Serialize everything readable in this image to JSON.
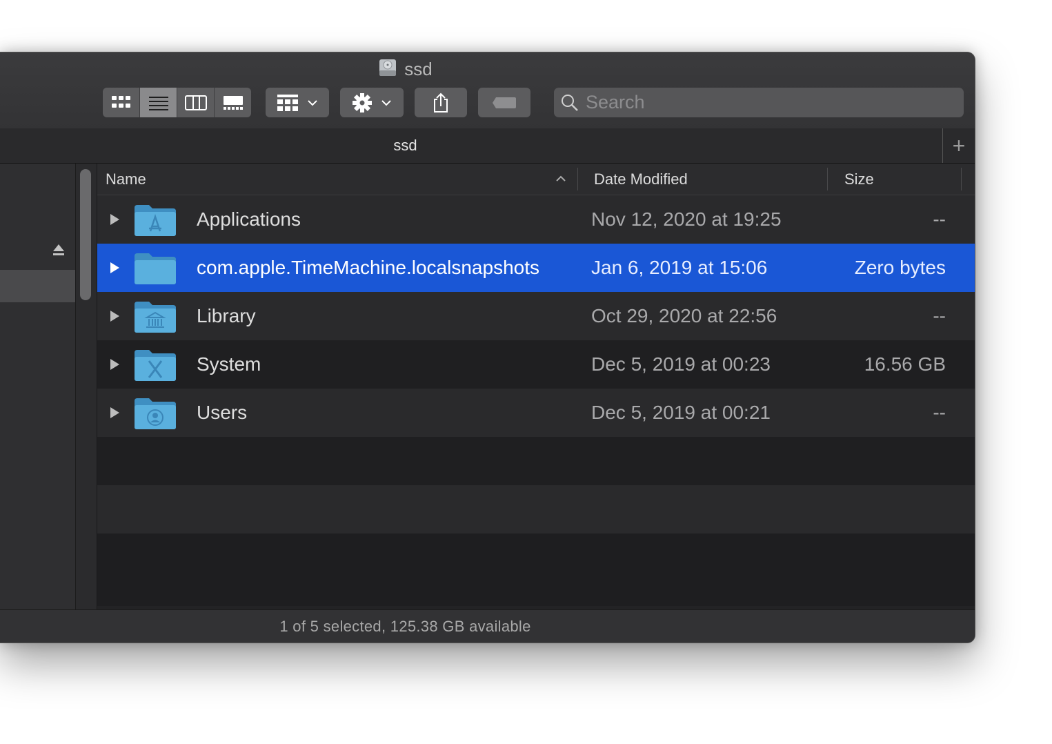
{
  "window": {
    "title": "ssd",
    "tab_title": "ssd",
    "tab_add_label": "+"
  },
  "toolbar": {
    "view_modes": [
      "icon-view",
      "list-view",
      "column-view",
      "gallery-view"
    ],
    "active_view": "list-view",
    "search_placeholder": "Search"
  },
  "list": {
    "columns": {
      "name": "Name",
      "date": "Date Modified",
      "size": "Size"
    },
    "rows": [
      {
        "name": "Applications",
        "date": "Nov 12, 2020 at 19:25",
        "size": "--",
        "icon": "applications-folder-icon",
        "selected": false
      },
      {
        "name": "com.apple.TimeMachine.localsnapshots",
        "date": "Jan 6, 2019 at 15:06",
        "size": "Zero bytes",
        "icon": "folder-icon",
        "selected": true
      },
      {
        "name": "Library",
        "date": "Oct 29, 2020 at 22:56",
        "size": "--",
        "icon": "library-folder-icon",
        "selected": false
      },
      {
        "name": "System",
        "date": "Dec 5, 2019 at 00:23",
        "size": "16.56 GB",
        "icon": "system-folder-icon",
        "selected": false
      },
      {
        "name": "Users",
        "date": "Dec 5, 2019 at 00:21",
        "size": "--",
        "icon": "users-folder-icon",
        "selected": false
      }
    ]
  },
  "pathbar": {
    "root": "ssd",
    "current": "com.apple.TimeMachine.localsnapshots"
  },
  "status": {
    "text": "1 of 5 selected, 125.38 GB available"
  },
  "colors": {
    "selection": "#1a57d6",
    "folder": "#5ab0de"
  }
}
